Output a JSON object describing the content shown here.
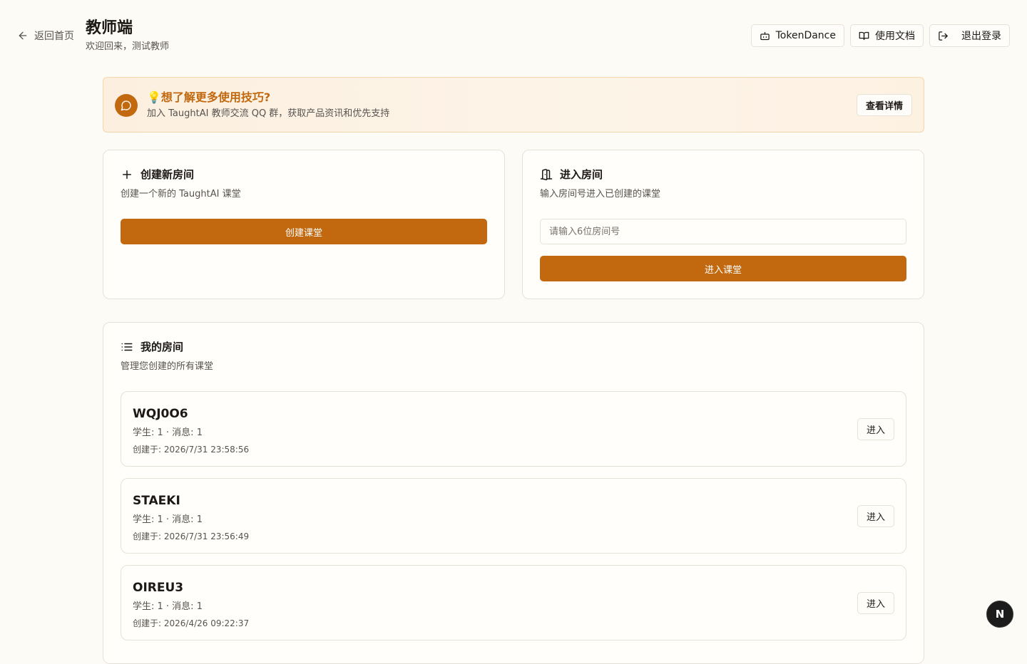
{
  "header": {
    "back_label": "返回首页",
    "title": "教师端",
    "subtitle": "欢迎回来，测试教师",
    "actions": {
      "tokendance": "TokenDance",
      "docs": "使用文档",
      "logout": "退出登录"
    }
  },
  "banner": {
    "title": "💡想了解更多使用技巧?",
    "description": "加入 TaughtAI 教师交流 QQ 群，获取产品资讯和优先支持",
    "button": "查看详情"
  },
  "create_card": {
    "title": "创建新房间",
    "description": "创建一个新的 TaughtAI 课堂",
    "button": "创建课堂"
  },
  "join_card": {
    "title": "进入房间",
    "description": "输入房间号进入已创建的课堂",
    "input_placeholder": "请输入6位房间号",
    "input_value": "",
    "button": "进入课堂"
  },
  "rooms": {
    "title": "我的房间",
    "description": "管理您创建的所有课堂",
    "enter_label": "进入",
    "items": [
      {
        "code": "WQJ0O6",
        "stats": "学生: 1 · 消息: 1",
        "created": "创建于: 2026/7/31 23:58:56"
      },
      {
        "code": "STAEKI",
        "stats": "学生: 1 · 消息: 1",
        "created": "创建于: 2026/7/31 23:56:49"
      },
      {
        "code": "OIREU3",
        "stats": "学生: 1 · 消息: 1",
        "created": "创建于: 2026/4/26 09:22:37"
      }
    ]
  },
  "dev_badge": "N",
  "colors": {
    "accent": "#c2690f",
    "background": "#fdfbf6",
    "border": "#e7e2d8",
    "banner_bg": "#fcefdf"
  }
}
